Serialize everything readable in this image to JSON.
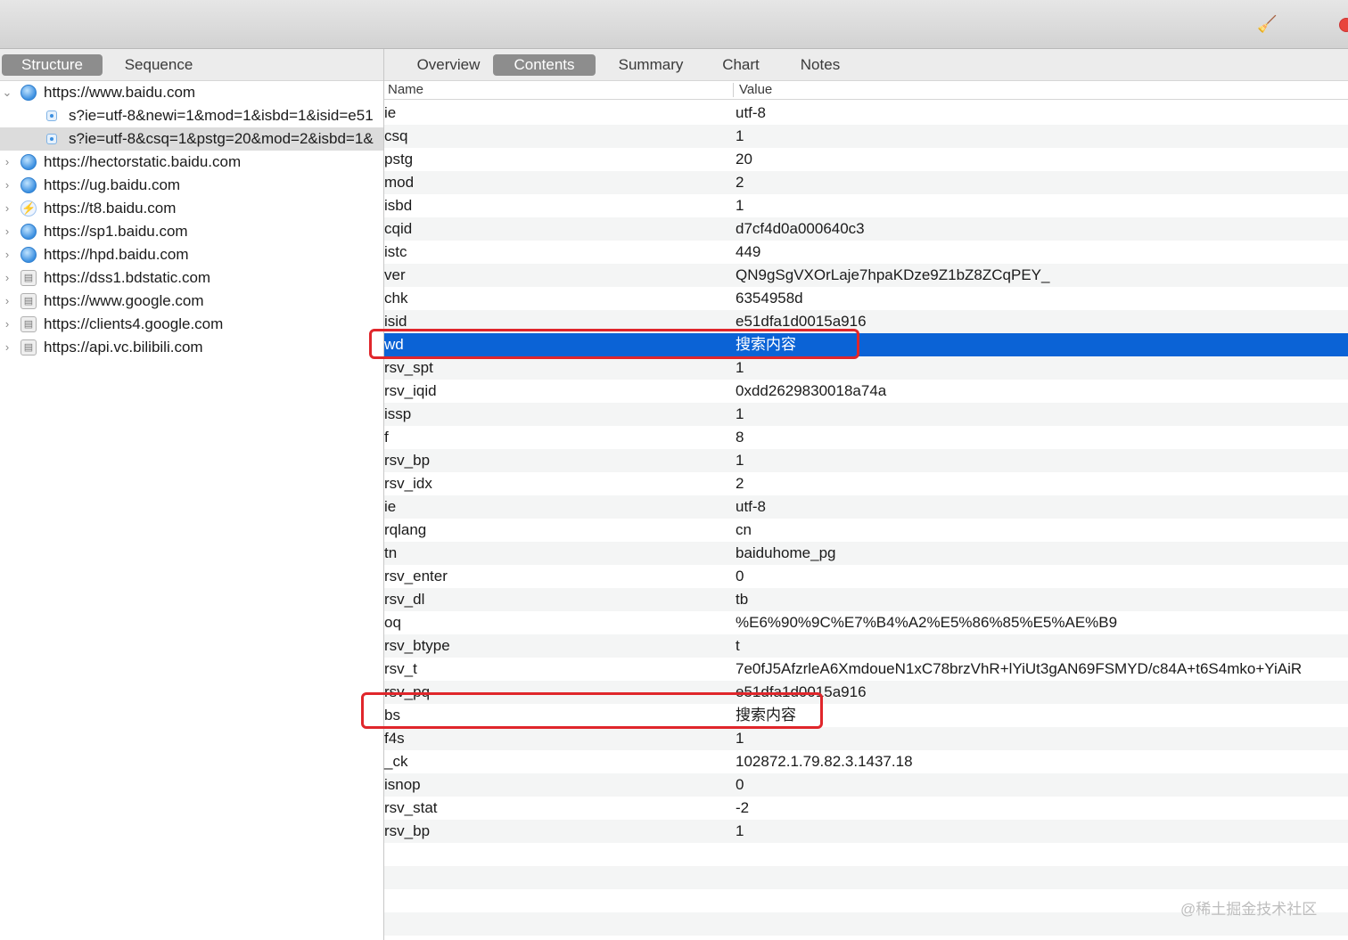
{
  "toolbar": {
    "clean_icon": "broom-icon",
    "record_icon": "record-icon",
    "record_color": "#e8453c"
  },
  "left_tabs": [
    {
      "label": "Structure",
      "active": true
    },
    {
      "label": "Sequence",
      "active": false
    }
  ],
  "right_tabs": [
    {
      "label": "Overview",
      "active": false
    },
    {
      "label": "Contents",
      "active": true
    },
    {
      "label": "Summary",
      "active": false
    },
    {
      "label": "Chart",
      "active": false
    },
    {
      "label": "Notes",
      "active": false
    }
  ],
  "tree": [
    {
      "type": "host",
      "label": "https://www.baidu.com",
      "icon": "globe-icon",
      "expanded": true
    },
    {
      "type": "request",
      "label": "s?ie=utf-8&newi=1&mod=1&isbd=1&isid=e51",
      "icon": "request-icon",
      "selected": false
    },
    {
      "type": "request",
      "label": "s?ie=utf-8&csq=1&pstg=20&mod=2&isbd=1&",
      "icon": "request-icon",
      "selected": true
    },
    {
      "type": "host",
      "label": "https://hectorstatic.baidu.com",
      "icon": "globe-icon"
    },
    {
      "type": "host",
      "label": "https://ug.baidu.com",
      "icon": "globe-icon"
    },
    {
      "type": "host",
      "label": "https://t8.baidu.com",
      "icon": "bolt-icon"
    },
    {
      "type": "host",
      "label": "https://sp1.baidu.com",
      "icon": "globe-icon"
    },
    {
      "type": "host",
      "label": "https://hpd.baidu.com",
      "icon": "globe-icon"
    },
    {
      "type": "host",
      "label": "https://dss1.bdstatic.com",
      "icon": "lock-icon"
    },
    {
      "type": "host",
      "label": "https://www.google.com",
      "icon": "lock-icon"
    },
    {
      "type": "host",
      "label": "https://clients4.google.com",
      "icon": "lock-icon"
    },
    {
      "type": "host",
      "label": "https://api.vc.bilibili.com",
      "icon": "lock-icon"
    }
  ],
  "table": {
    "columns": {
      "name": "Name",
      "value": "Value"
    },
    "rows": [
      {
        "name": "ie",
        "value": "utf-8"
      },
      {
        "name": "csq",
        "value": "1"
      },
      {
        "name": "pstg",
        "value": "20"
      },
      {
        "name": "mod",
        "value": "2"
      },
      {
        "name": "isbd",
        "value": "1"
      },
      {
        "name": "cqid",
        "value": "d7cf4d0a000640c3"
      },
      {
        "name": "istc",
        "value": "449"
      },
      {
        "name": "ver",
        "value": "QN9gSgVXOrLaje7hpaKDze9Z1bZ8ZCqPEY_"
      },
      {
        "name": "chk",
        "value": "6354958d"
      },
      {
        "name": "isid",
        "value": "e51dfa1d0015a916"
      },
      {
        "name": "wd",
        "value": "搜索内容",
        "selected": true
      },
      {
        "name": "rsv_spt",
        "value": "1"
      },
      {
        "name": "rsv_iqid",
        "value": "0xdd2629830018a74a"
      },
      {
        "name": "issp",
        "value": "1"
      },
      {
        "name": "f",
        "value": "8"
      },
      {
        "name": "rsv_bp",
        "value": "1"
      },
      {
        "name": "rsv_idx",
        "value": "2"
      },
      {
        "name": "ie",
        "value": "utf-8"
      },
      {
        "name": "rqlang",
        "value": "cn"
      },
      {
        "name": "tn",
        "value": "baiduhome_pg"
      },
      {
        "name": "rsv_enter",
        "value": "0"
      },
      {
        "name": "rsv_dl",
        "value": "tb"
      },
      {
        "name": "oq",
        "value": "%E6%90%9C%E7%B4%A2%E5%86%85%E5%AE%B9"
      },
      {
        "name": "rsv_btype",
        "value": "t"
      },
      {
        "name": "rsv_t",
        "value": "7e0fJ5AfzrleA6XmdoueN1xC78brzVhR+lYiUt3gAN69FSMYD/c84A+t6S4mko+YiAiR"
      },
      {
        "name": "rsv_pq",
        "value": "e51dfa1d0015a916"
      },
      {
        "name": "bs",
        "value": "搜索内容"
      },
      {
        "name": "f4s",
        "value": "1"
      },
      {
        "name": "_ck",
        "value": "102872.1.79.82.3.1437.18"
      },
      {
        "name": "isnop",
        "value": "0"
      },
      {
        "name": "rsv_stat",
        "value": "-2"
      },
      {
        "name": "rsv_bp",
        "value": "1"
      }
    ]
  },
  "highlight_color": "#e0262b",
  "selection_color": "#0b63d6",
  "watermark": "@稀土掘金技术社区"
}
